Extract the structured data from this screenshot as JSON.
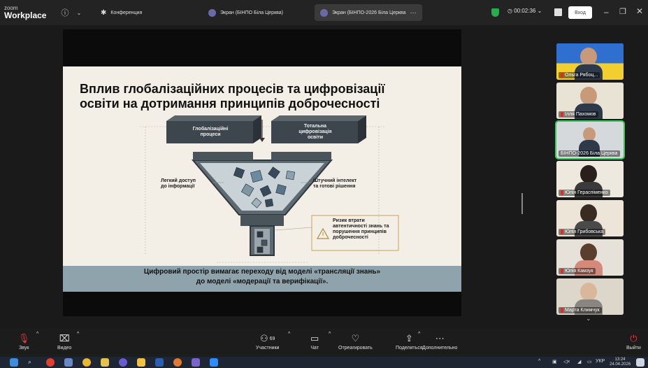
{
  "app": {
    "brand_top": "zoom",
    "brand_bottom": "Workplace"
  },
  "tabs": {
    "meeting": "Конференция",
    "screen_1": "Экран (БІНПО Біла Церква)",
    "screen_2": "Экран (БІНПО-2026 Біла Церква"
  },
  "header": {
    "timer": "00:02:36",
    "signin": "Вход"
  },
  "slide": {
    "title_1": "Вплив глобалізаційних процесів та цифровізації",
    "title_2": "освіти на дотримання принципів доброчесності",
    "box_left_1": "Глобалізаційні",
    "box_left_2": "процеси",
    "box_right_1": "Тотальна",
    "box_right_2": "цифровізація",
    "box_right_3": "освіти",
    "label_left_1": "Легкий доступ",
    "label_left_2": "до інформації",
    "label_right_1": "Штучний інтелект",
    "label_right_2": "та готові рішення",
    "risk_1": "Ризик втрати",
    "risk_2": "автентичності знань та",
    "risk_3": "порушення принципів",
    "risk_4": "доброчесності",
    "footer_1": "Цифровий простір вимагає переходу від моделі «трансляції знань»",
    "footer_2": "до моделі «модерації та верифікації»."
  },
  "participants": [
    {
      "name": "Ольга Рябоц..."
    },
    {
      "name": "Ілля Пахомов"
    },
    {
      "name": "БІНПО-2026 Біла Церква"
    },
    {
      "name": "Юлія Гераспіменко"
    },
    {
      "name": "Юлія Грибовська"
    },
    {
      "name": "Юлія Камзук"
    },
    {
      "name": "Марта Климчук"
    }
  ],
  "toolbar": {
    "audio": "Звук",
    "video": "Видео",
    "participants": "Участники",
    "participants_count": "69",
    "chat": "Чат",
    "react": "Отреагировать",
    "share": "Поделиться",
    "more": "Дополнительно",
    "leave": "Выйти"
  },
  "taskbar": {
    "lang": "УКР",
    "time": "13:24",
    "date": "24.04.2026"
  },
  "colors": {
    "speaking": "#35c759",
    "leave": "#e03a3a",
    "accent": "#21b04b"
  }
}
